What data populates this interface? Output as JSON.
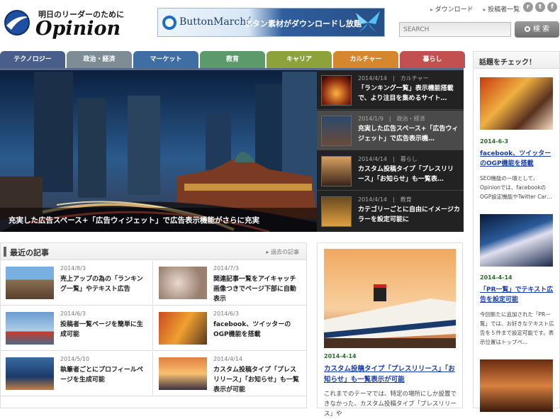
{
  "header": {
    "tagline": "明日のリーダーのために",
    "title": "Opinion",
    "links": [
      "ダウンロード",
      "投稿者一覧"
    ],
    "social": [
      "rss-icon",
      "twitter-icon",
      "facebook-icon"
    ],
    "search_placeholder": "SEARCH",
    "search_button": "検 索"
  },
  "banner": {
    "brand": "ButtonMarché",
    "text": "ボタン素材がダウンロードし放題"
  },
  "nav": {
    "items": [
      {
        "label": "テクノロジー",
        "color": "#4a5e8c"
      },
      {
        "label": "政治・経済",
        "color": "#7e8c96"
      },
      {
        "label": "マーケット",
        "color": "#3e6ea4"
      },
      {
        "label": "教育",
        "color": "#5c9a6c"
      },
      {
        "label": "キャリア",
        "color": "#8ea23c"
      },
      {
        "label": "カルチャー",
        "color": "#d6862c"
      },
      {
        "label": "暮らし",
        "color": "#c25050"
      }
    ]
  },
  "hero": {
    "caption": "充実した広告スペース+「広告ウィジェット」で広告表示機能がさらに充実",
    "list": [
      {
        "date": "2014/4/14",
        "category": "カルチャー",
        "title": "「ランキング一覧」表示機能搭載で、より注目を集めるサイト…"
      },
      {
        "date": "2014/1/9",
        "category": "政治・経済",
        "title": "充実した広告スペース+「広告ウィジェット」で広告表示機…"
      },
      {
        "date": "2014/4/14",
        "category": "暮らし",
        "title": "カスタム投稿タイプ「プレスリリース」「お知らせ」も一覧表…"
      },
      {
        "date": "2014/4/14",
        "category": "教育",
        "title": "カテゴリーごとに自由にイメージカラーを設定可能に"
      }
    ]
  },
  "recent": {
    "title": "最近の記事",
    "more": "過去の記事",
    "items": [
      {
        "date": "2014/8/3",
        "title": "売上アップの為の「ランキング一覧」やテキスト広告"
      },
      {
        "date": "2014/7/3",
        "title": "関連記事一覧をアイキャッチ画像つきでページ下部に自動表示"
      },
      {
        "date": "2014/6/3",
        "title": "投稿者一覧ページを簡単に生成可能"
      },
      {
        "date": "2014/6/3",
        "title": "facebook、ツイッターのOGP機能を搭載"
      },
      {
        "date": "2014/5/10",
        "title": "執筆者ごとにプロフィールページを生成可能"
      },
      {
        "date": "2014/4/14",
        "title": "カスタム投稿タイプ「プレスリリース」「お知らせ」も一覧表示が可能"
      }
    ]
  },
  "featured": {
    "date": "2014-4-14",
    "title": "カスタム投稿タイプ「プレスリリース」「お知らせ」も一覧表示が可能",
    "desc": "これまでのテーマでは、特定の場所にしか設置できなかった、カスタム投稿タイプ「プレスリリース」や"
  },
  "sidebar": {
    "title": "話題をチェック！",
    "items": [
      {
        "date": "2014-6-3",
        "title": "facebook、ツイッターのOGP機能を搭載",
        "desc": "SEO機能の一環として、Opinionでは、facebookのOGP設定機能やTwitter Car…"
      },
      {
        "date": "2014-4-14",
        "title": "「PR一覧」でテキスト広告を設定可能",
        "desc": "今回新たに追加された「PR一覧」では、お好きなテキスト広告を５件まで設定可能です。表示位置はトップペ…"
      }
    ]
  }
}
